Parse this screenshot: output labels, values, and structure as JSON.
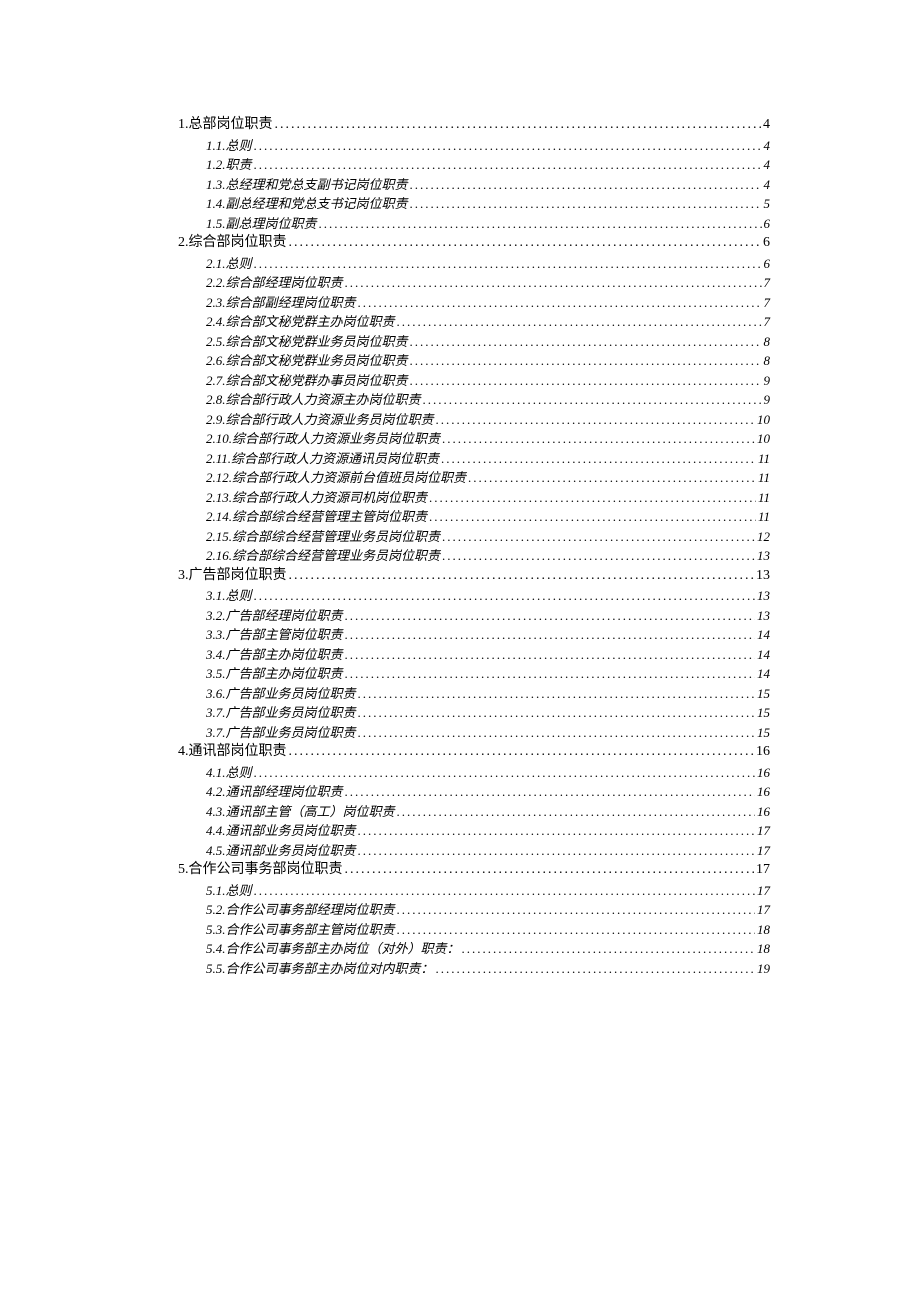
{
  "toc": [
    {
      "level": 1,
      "title": "1.总部岗位职责",
      "page": "4"
    },
    {
      "level": 2,
      "title": "1.1.总则",
      "page": "4"
    },
    {
      "level": 2,
      "title": "1.2.职责",
      "page": "4"
    },
    {
      "level": 2,
      "title": "1.3.总经理和党总支副书记岗位职责",
      "page": "4"
    },
    {
      "level": 2,
      "title": "1.4.副总经理和党总支书记岗位职责",
      "page": "5"
    },
    {
      "level": 2,
      "title": "1.5.副总理岗位职责",
      "page": "6"
    },
    {
      "level": 1,
      "title": "2.综合部岗位职责",
      "page": "6"
    },
    {
      "level": 2,
      "title": "2.1.总则",
      "page": "6"
    },
    {
      "level": 2,
      "title": "2.2.综合部经理岗位职责",
      "page": "7"
    },
    {
      "level": 2,
      "title": "2.3.综合部副经理岗位职责",
      "page": "7"
    },
    {
      "level": 2,
      "title": "2.4.综合部文秘党群主办岗位职责",
      "page": "7"
    },
    {
      "level": 2,
      "title": "2.5.综合部文秘党群业务员岗位职责",
      "page": "8"
    },
    {
      "level": 2,
      "title": "2.6.综合部文秘党群业务员岗位职责",
      "page": "8"
    },
    {
      "level": 2,
      "title": "2.7.综合部文秘党群办事员岗位职责",
      "page": "9"
    },
    {
      "level": 2,
      "title": "2.8.综合部行政人力资源主办岗位职责",
      "page": "9"
    },
    {
      "level": 2,
      "title": "2.9.综合部行政人力资源业务员岗位职责",
      "page": "10"
    },
    {
      "level": 2,
      "title": "2.10.综合部行政人力资源业务员岗位职责",
      "page": "10"
    },
    {
      "level": 2,
      "title": "2.11.综合部行政人力资源通讯员岗位职责",
      "page": "11"
    },
    {
      "level": 2,
      "title": "2.12.综合部行政人力资源前台值班员岗位职责",
      "page": "11"
    },
    {
      "level": 2,
      "title": "2.13.综合部行政人力资源司机岗位职责",
      "page": "11"
    },
    {
      "level": 2,
      "title": "2.14.综合部综合经营管理主管岗位职责",
      "page": "11"
    },
    {
      "level": 2,
      "title": "2.15.综合部综合经营管理业务员岗位职责",
      "page": "12"
    },
    {
      "level": 2,
      "title": "2.16.综合部综合经营管理业务员岗位职责",
      "page": "13"
    },
    {
      "level": 1,
      "title": "3.广告部岗位职责",
      "page": "13"
    },
    {
      "level": 2,
      "title": "3.1.总则",
      "page": "13"
    },
    {
      "level": 2,
      "title": "3.2.广告部经理岗位职责",
      "page": "13"
    },
    {
      "level": 2,
      "title": "3.3.广告部主管岗位职责",
      "page": "14"
    },
    {
      "level": 2,
      "title": "3.4.广告部主办岗位职责",
      "page": "14"
    },
    {
      "level": 2,
      "title": "3.5.广告部主办岗位职责",
      "page": "14"
    },
    {
      "level": 2,
      "title": "3.6.广告部业务员岗位职责",
      "page": "15"
    },
    {
      "level": 2,
      "title": "3.7.广告部业务员岗位职责",
      "page": "15"
    },
    {
      "level": 2,
      "title": "3.7.广告部业务员岗位职责",
      "page": "15"
    },
    {
      "level": 1,
      "title": "4.通讯部岗位职责",
      "page": "16"
    },
    {
      "level": 2,
      "title": "4.1.总则",
      "page": "16"
    },
    {
      "level": 2,
      "title": "4.2.通讯部经理岗位职责",
      "page": "16"
    },
    {
      "level": 2,
      "title": "4.3.通讯部主管（高工）岗位职责",
      "page": "16"
    },
    {
      "level": 2,
      "title": "4.4.通讯部业务员岗位职责",
      "page": "17"
    },
    {
      "level": 2,
      "title": "4.5.通讯部业务员岗位职责",
      "page": "17"
    },
    {
      "level": 1,
      "title": "5.合作公司事务部岗位职责",
      "page": "17"
    },
    {
      "level": 2,
      "title": "5.1.总则",
      "page": "17"
    },
    {
      "level": 2,
      "title": "5.2.合作公司事务部经理岗位职责",
      "page": "17"
    },
    {
      "level": 2,
      "title": "5.3.合作公司事务部主管岗位职责",
      "page": "18"
    },
    {
      "level": 2,
      "title": "5.4.合作公司事务部主办岗位（对外）职责：",
      "page": "18"
    },
    {
      "level": 2,
      "title": "5.5.合作公司事务部主办岗位对内职责：",
      "page": "19"
    }
  ]
}
